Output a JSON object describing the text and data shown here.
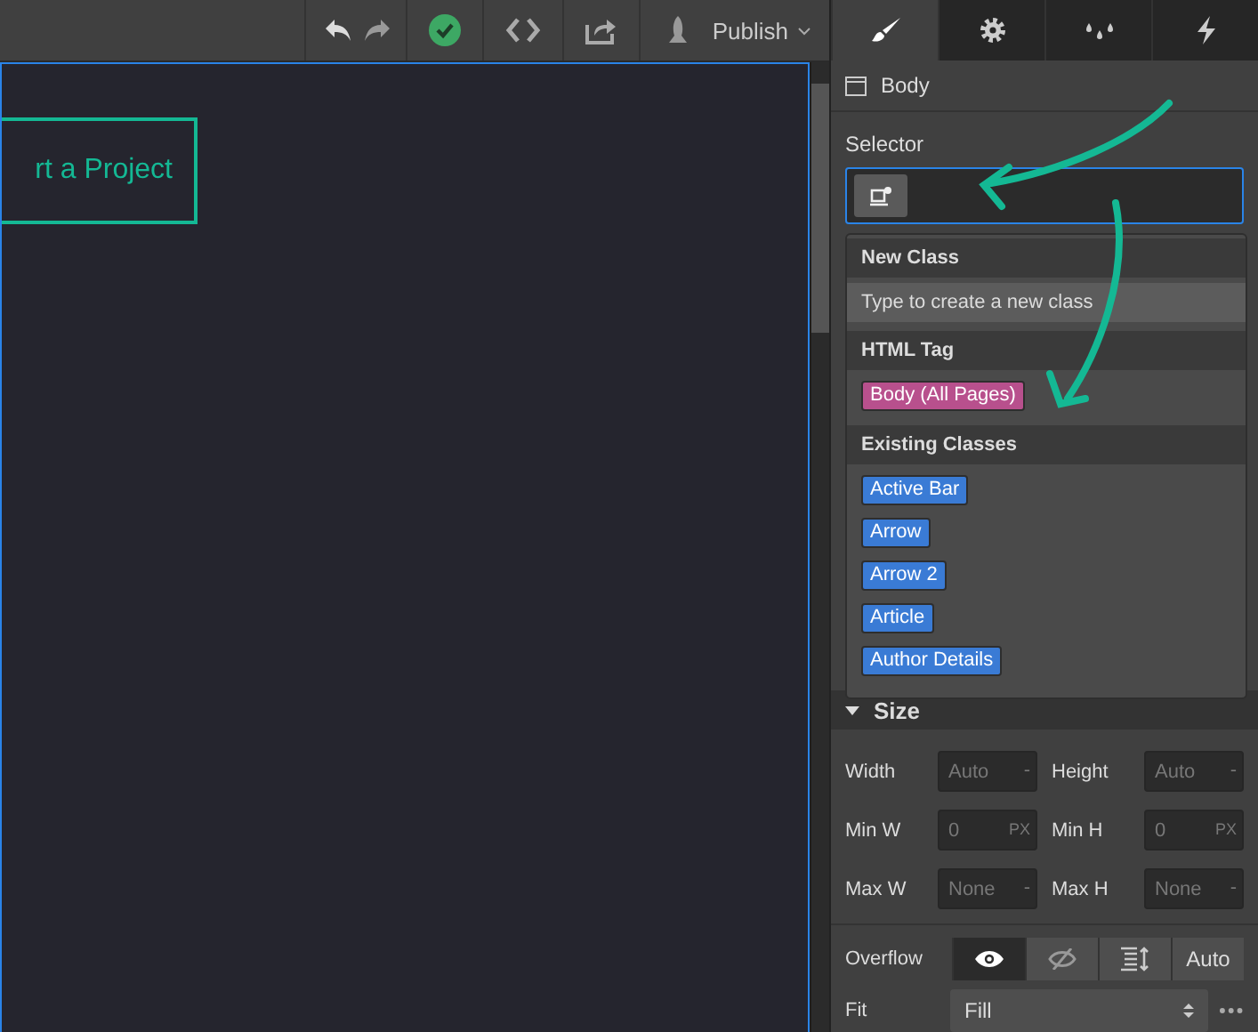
{
  "toolbar": {
    "tools": [
      {
        "kind": "undo"
      },
      {
        "kind": "redo"
      },
      {
        "kind": "check"
      },
      {
        "kind": "code"
      },
      {
        "kind": "export"
      }
    ],
    "publish": "Publish"
  },
  "tabs": [
    {
      "kind": "style",
      "selected": true
    },
    {
      "kind": "settings",
      "selected": false
    },
    {
      "kind": "drops",
      "selected": false
    },
    {
      "kind": "interactions",
      "selected": false
    }
  ],
  "canvas": {
    "button": "rt a Project"
  },
  "element": "Body",
  "selector": {
    "label": "Selector"
  },
  "dropdown": {
    "sections": [
      {
        "heading": "New Class",
        "items": [
          {
            "kind": "hint",
            "label": "Type to create a new class"
          }
        ]
      },
      {
        "heading": "HTML Tag",
        "items": [
          {
            "kind": "tag",
            "label": "Body (All Pages)"
          }
        ]
      },
      {
        "heading": "Existing Classes",
        "items": [
          {
            "kind": "class",
            "label": "Active Bar"
          },
          {
            "kind": "class",
            "label": "Arrow"
          },
          {
            "kind": "class",
            "label": "Arrow 2"
          },
          {
            "kind": "class",
            "label": "Article"
          },
          {
            "kind": "class",
            "label": "Author Details"
          }
        ]
      }
    ]
  },
  "size": {
    "title": "Size",
    "expanded": true,
    "fields": [
      {
        "label": "Width",
        "placeholder": "Auto",
        "unit": "-"
      },
      {
        "label": "Height",
        "placeholder": "Auto",
        "unit": "-"
      },
      {
        "label": "Min W",
        "placeholder": "0",
        "unit": "PX"
      },
      {
        "label": "Min H",
        "placeholder": "0",
        "unit": "PX"
      },
      {
        "label": "Max W",
        "placeholder": "None",
        "unit": "-"
      },
      {
        "label": "Max H",
        "placeholder": "None",
        "unit": "-"
      }
    ]
  },
  "overflow": {
    "label": "Overflow",
    "options": [
      {
        "kind": "visible",
        "selected": true
      },
      {
        "kind": "hidden",
        "selected": false
      },
      {
        "kind": "scroll",
        "selected": false
      },
      {
        "kind": "auto",
        "label": "Auto",
        "selected": false
      }
    ]
  },
  "fit": {
    "label": "Fit",
    "value": "Fill"
  }
}
